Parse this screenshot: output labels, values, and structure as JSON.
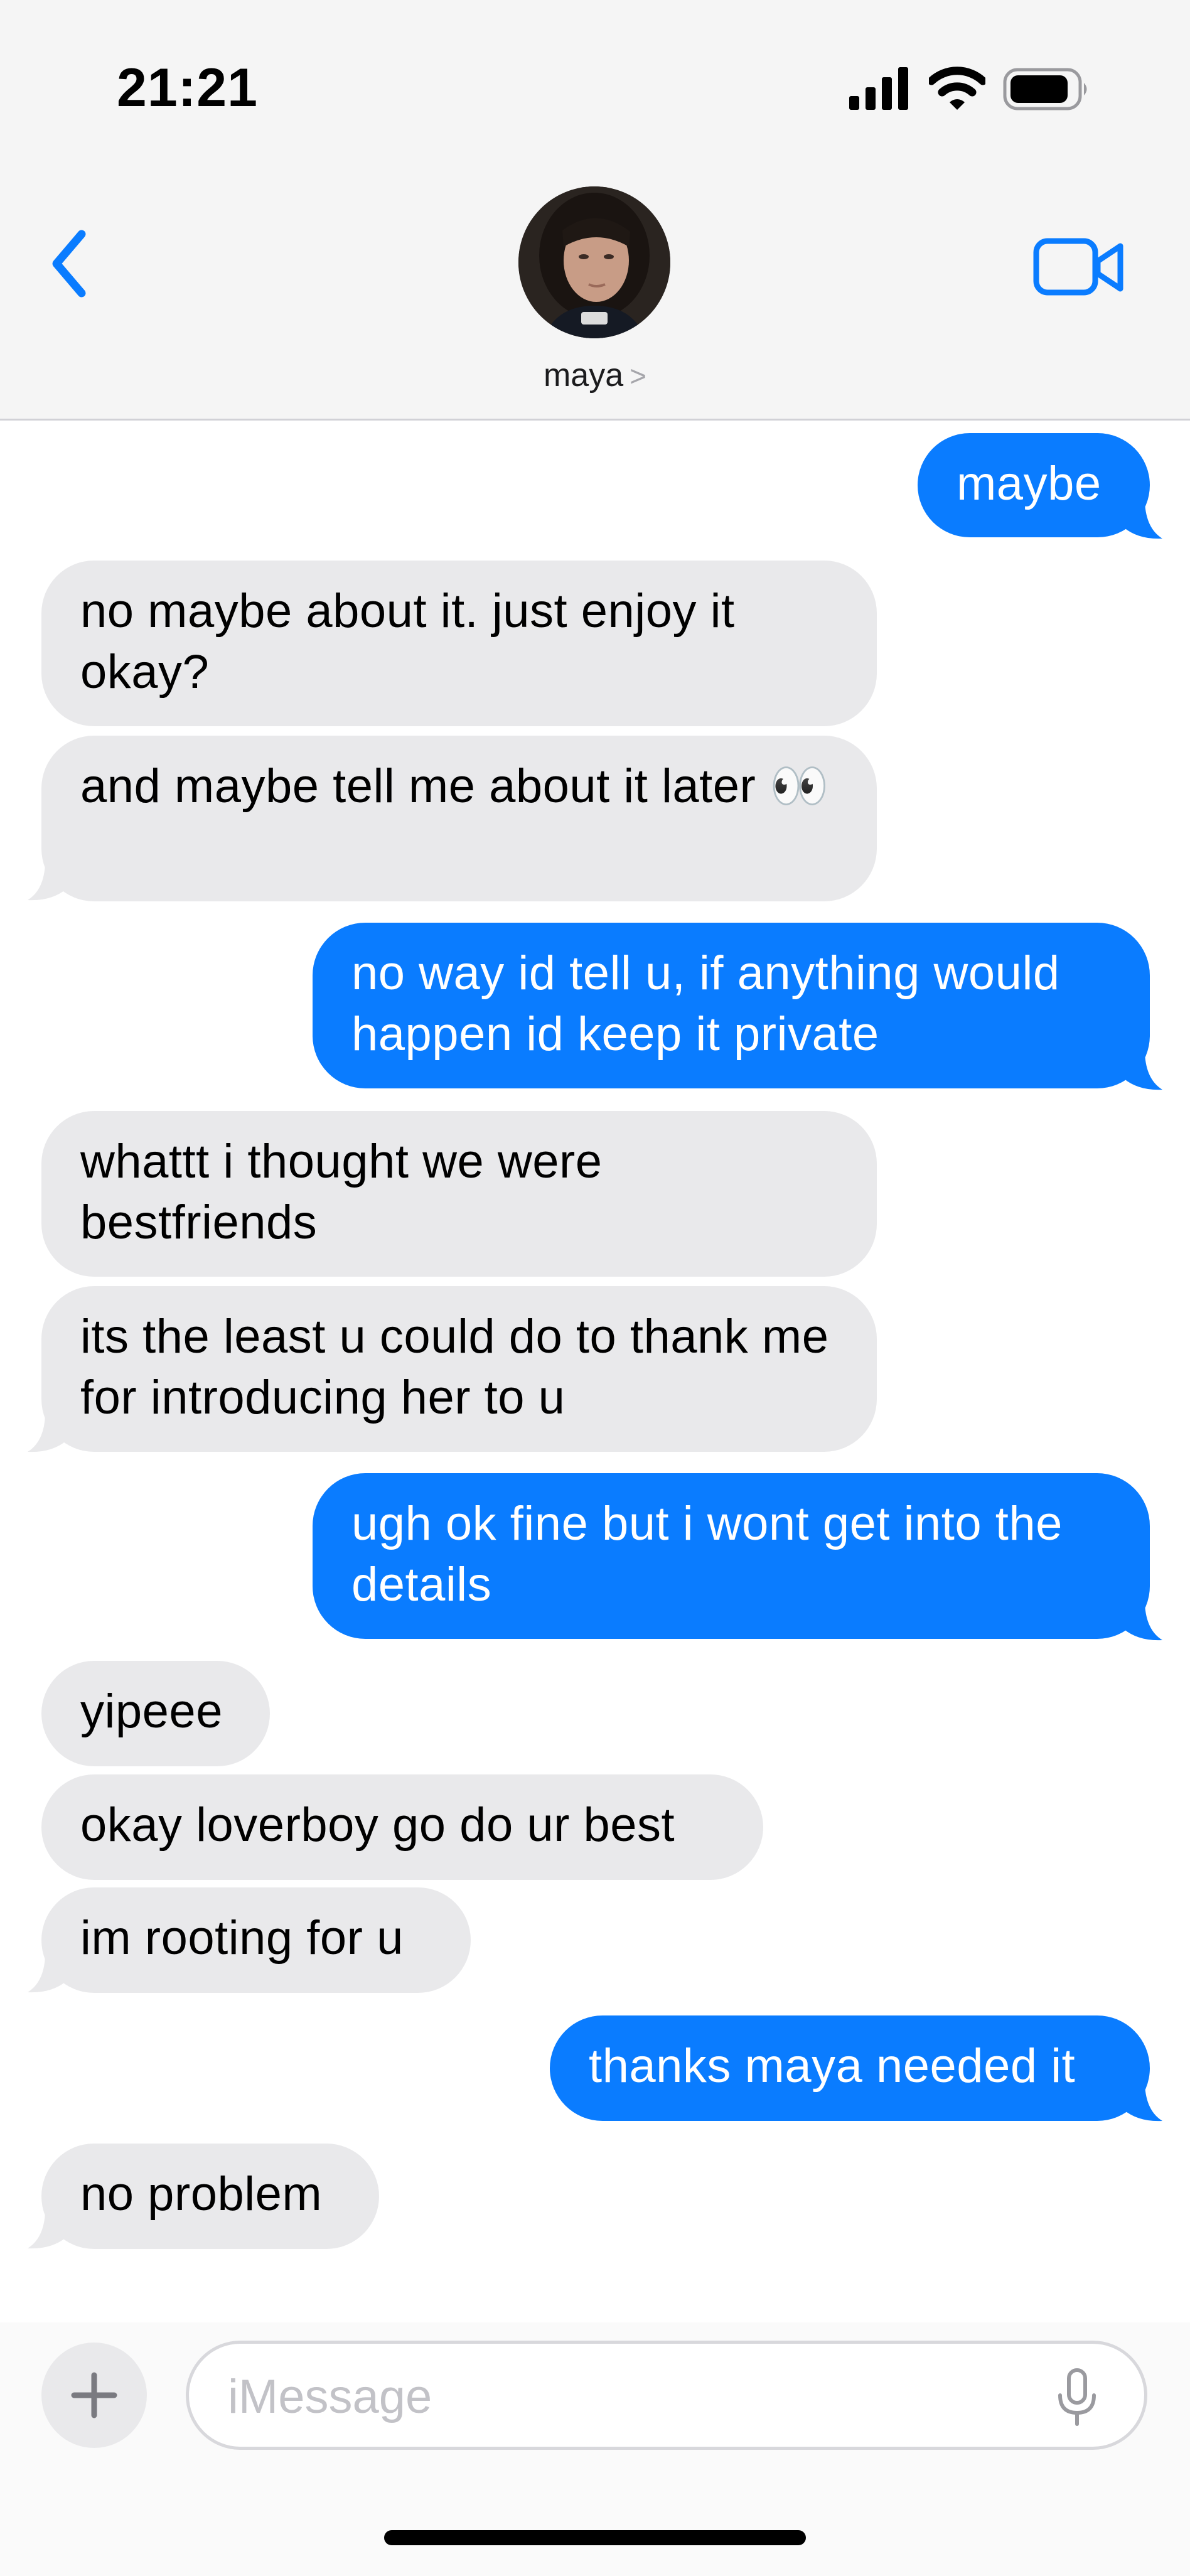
{
  "status_bar": {
    "time": "21:21"
  },
  "header": {
    "contact_name": "maya",
    "name_chevron": ">",
    "back_icon": "chevron-left-icon",
    "video_icon": "video-camera-icon",
    "accent": "#0a7cff"
  },
  "messages": [
    {
      "from": "me",
      "text": "maybe"
    },
    {
      "from": "them",
      "text": "no maybe about it. just enjoy it okay?"
    },
    {
      "from": "them",
      "text": "and maybe tell me about it later 👀"
    },
    {
      "from": "me",
      "text": "no way id tell u, if anything would happen id keep it private"
    },
    {
      "from": "them",
      "text": "whattt i thought we were bestfriends"
    },
    {
      "from": "them",
      "text": "its the least u could do to thank me for introducing her to u"
    },
    {
      "from": "me",
      "text": "ugh ok fine but i wont get into the details"
    },
    {
      "from": "them",
      "text": "yipeee"
    },
    {
      "from": "them",
      "text": "okay loverboy go do ur best"
    },
    {
      "from": "them",
      "text": "im rooting for u"
    },
    {
      "from": "me",
      "text": "thanks maya needed it"
    },
    {
      "from": "them",
      "text": "no problem"
    }
  ],
  "composer": {
    "placeholder": "iMessage",
    "add_icon": "plus-icon",
    "mic_icon": "microphone-icon"
  },
  "colors": {
    "incoming_bubble": "#e9e9eb",
    "outgoing_bubble": "#0a7cff"
  }
}
